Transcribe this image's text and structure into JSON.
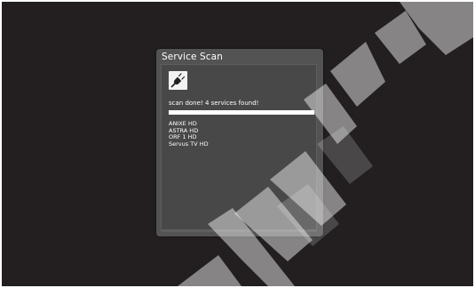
{
  "dialog": {
    "title": "Service Scan",
    "status": "scan done! 4 services found!",
    "progress": 1.0
  },
  "services": [
    "ANIXE HD",
    "ASTRA HD",
    "ORF 1 HD",
    "Servus TV HD"
  ],
  "icons": {
    "scan": "plug-icon"
  },
  "colors": {
    "screen_bg": "#231f20",
    "dialog_bg": "#535353",
    "body_bg": "#484848",
    "text": "#ffffff"
  }
}
